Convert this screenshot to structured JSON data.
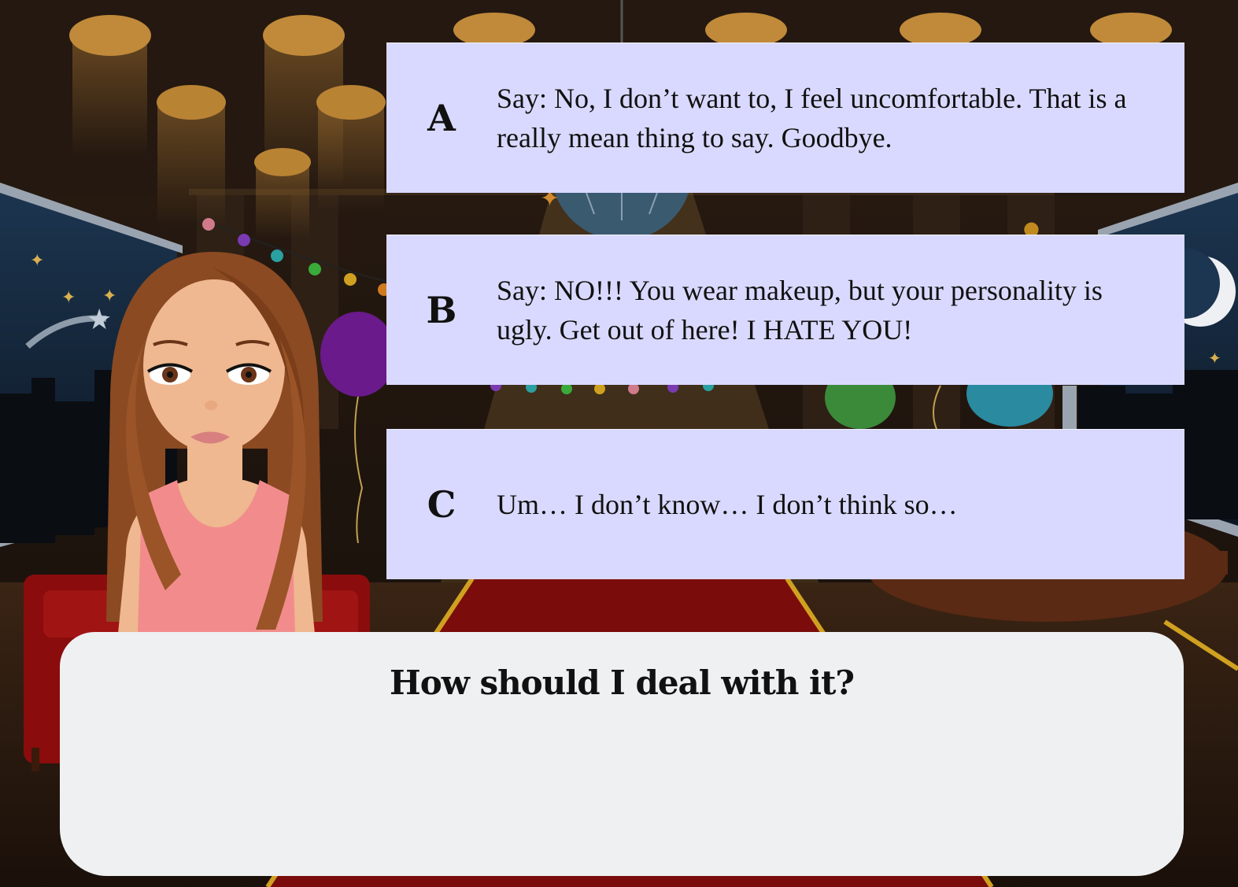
{
  "choices": [
    {
      "letter": "A",
      "text": "Say: No, I don’t want to, I feel uncomfortable. That is a really mean thing to say. Goodbye."
    },
    {
      "letter": "B",
      "text": "Say: NO!!! You wear makeup, but your personality is ugly. Get out of here! I HATE YOU!"
    },
    {
      "letter": "C",
      "text": "Um… I don’t know… I don’t think so…"
    }
  ],
  "dialogue": {
    "question": "How should I deal with it?"
  },
  "colors": {
    "choice_background": "#d9d9ff",
    "dialogue_background": "#eff0f2",
    "carpet": "#7a0c0c",
    "dress": "#f28c8c",
    "hair": "#8b4a22"
  },
  "icons": {
    "character": "girl-character-portrait",
    "moon": "crescent-moon-icon"
  }
}
